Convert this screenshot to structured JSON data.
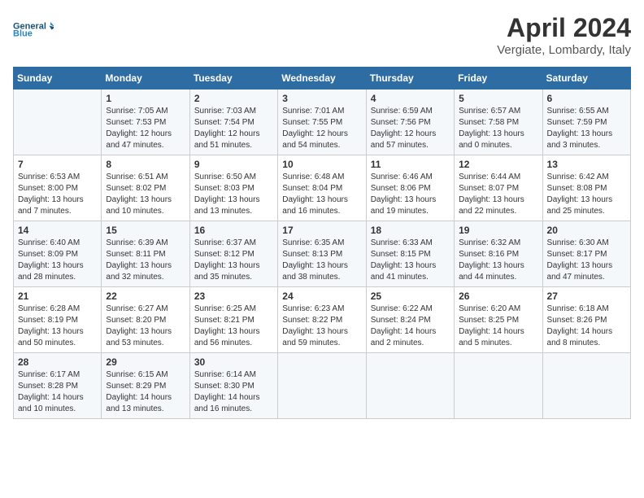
{
  "logo": {
    "text_general": "General",
    "text_blue": "Blue"
  },
  "title": "April 2024",
  "location": "Vergiate, Lombardy, Italy",
  "weekdays": [
    "Sunday",
    "Monday",
    "Tuesday",
    "Wednesday",
    "Thursday",
    "Friday",
    "Saturday"
  ],
  "weeks": [
    [
      {
        "day": "",
        "sunrise": "",
        "sunset": "",
        "daylight": ""
      },
      {
        "day": "1",
        "sunrise": "Sunrise: 7:05 AM",
        "sunset": "Sunset: 7:53 PM",
        "daylight": "Daylight: 12 hours and 47 minutes."
      },
      {
        "day": "2",
        "sunrise": "Sunrise: 7:03 AM",
        "sunset": "Sunset: 7:54 PM",
        "daylight": "Daylight: 12 hours and 51 minutes."
      },
      {
        "day": "3",
        "sunrise": "Sunrise: 7:01 AM",
        "sunset": "Sunset: 7:55 PM",
        "daylight": "Daylight: 12 hours and 54 minutes."
      },
      {
        "day": "4",
        "sunrise": "Sunrise: 6:59 AM",
        "sunset": "Sunset: 7:56 PM",
        "daylight": "Daylight: 12 hours and 57 minutes."
      },
      {
        "day": "5",
        "sunrise": "Sunrise: 6:57 AM",
        "sunset": "Sunset: 7:58 PM",
        "daylight": "Daylight: 13 hours and 0 minutes."
      },
      {
        "day": "6",
        "sunrise": "Sunrise: 6:55 AM",
        "sunset": "Sunset: 7:59 PM",
        "daylight": "Daylight: 13 hours and 3 minutes."
      }
    ],
    [
      {
        "day": "7",
        "sunrise": "Sunrise: 6:53 AM",
        "sunset": "Sunset: 8:00 PM",
        "daylight": "Daylight: 13 hours and 7 minutes."
      },
      {
        "day": "8",
        "sunrise": "Sunrise: 6:51 AM",
        "sunset": "Sunset: 8:02 PM",
        "daylight": "Daylight: 13 hours and 10 minutes."
      },
      {
        "day": "9",
        "sunrise": "Sunrise: 6:50 AM",
        "sunset": "Sunset: 8:03 PM",
        "daylight": "Daylight: 13 hours and 13 minutes."
      },
      {
        "day": "10",
        "sunrise": "Sunrise: 6:48 AM",
        "sunset": "Sunset: 8:04 PM",
        "daylight": "Daylight: 13 hours and 16 minutes."
      },
      {
        "day": "11",
        "sunrise": "Sunrise: 6:46 AM",
        "sunset": "Sunset: 8:06 PM",
        "daylight": "Daylight: 13 hours and 19 minutes."
      },
      {
        "day": "12",
        "sunrise": "Sunrise: 6:44 AM",
        "sunset": "Sunset: 8:07 PM",
        "daylight": "Daylight: 13 hours and 22 minutes."
      },
      {
        "day": "13",
        "sunrise": "Sunrise: 6:42 AM",
        "sunset": "Sunset: 8:08 PM",
        "daylight": "Daylight: 13 hours and 25 minutes."
      }
    ],
    [
      {
        "day": "14",
        "sunrise": "Sunrise: 6:40 AM",
        "sunset": "Sunset: 8:09 PM",
        "daylight": "Daylight: 13 hours and 28 minutes."
      },
      {
        "day": "15",
        "sunrise": "Sunrise: 6:39 AM",
        "sunset": "Sunset: 8:11 PM",
        "daylight": "Daylight: 13 hours and 32 minutes."
      },
      {
        "day": "16",
        "sunrise": "Sunrise: 6:37 AM",
        "sunset": "Sunset: 8:12 PM",
        "daylight": "Daylight: 13 hours and 35 minutes."
      },
      {
        "day": "17",
        "sunrise": "Sunrise: 6:35 AM",
        "sunset": "Sunset: 8:13 PM",
        "daylight": "Daylight: 13 hours and 38 minutes."
      },
      {
        "day": "18",
        "sunrise": "Sunrise: 6:33 AM",
        "sunset": "Sunset: 8:15 PM",
        "daylight": "Daylight: 13 hours and 41 minutes."
      },
      {
        "day": "19",
        "sunrise": "Sunrise: 6:32 AM",
        "sunset": "Sunset: 8:16 PM",
        "daylight": "Daylight: 13 hours and 44 minutes."
      },
      {
        "day": "20",
        "sunrise": "Sunrise: 6:30 AM",
        "sunset": "Sunset: 8:17 PM",
        "daylight": "Daylight: 13 hours and 47 minutes."
      }
    ],
    [
      {
        "day": "21",
        "sunrise": "Sunrise: 6:28 AM",
        "sunset": "Sunset: 8:19 PM",
        "daylight": "Daylight: 13 hours and 50 minutes."
      },
      {
        "day": "22",
        "sunrise": "Sunrise: 6:27 AM",
        "sunset": "Sunset: 8:20 PM",
        "daylight": "Daylight: 13 hours and 53 minutes."
      },
      {
        "day": "23",
        "sunrise": "Sunrise: 6:25 AM",
        "sunset": "Sunset: 8:21 PM",
        "daylight": "Daylight: 13 hours and 56 minutes."
      },
      {
        "day": "24",
        "sunrise": "Sunrise: 6:23 AM",
        "sunset": "Sunset: 8:22 PM",
        "daylight": "Daylight: 13 hours and 59 minutes."
      },
      {
        "day": "25",
        "sunrise": "Sunrise: 6:22 AM",
        "sunset": "Sunset: 8:24 PM",
        "daylight": "Daylight: 14 hours and 2 minutes."
      },
      {
        "day": "26",
        "sunrise": "Sunrise: 6:20 AM",
        "sunset": "Sunset: 8:25 PM",
        "daylight": "Daylight: 14 hours and 5 minutes."
      },
      {
        "day": "27",
        "sunrise": "Sunrise: 6:18 AM",
        "sunset": "Sunset: 8:26 PM",
        "daylight": "Daylight: 14 hours and 8 minutes."
      }
    ],
    [
      {
        "day": "28",
        "sunrise": "Sunrise: 6:17 AM",
        "sunset": "Sunset: 8:28 PM",
        "daylight": "Daylight: 14 hours and 10 minutes."
      },
      {
        "day": "29",
        "sunrise": "Sunrise: 6:15 AM",
        "sunset": "Sunset: 8:29 PM",
        "daylight": "Daylight: 14 hours and 13 minutes."
      },
      {
        "day": "30",
        "sunrise": "Sunrise: 6:14 AM",
        "sunset": "Sunset: 8:30 PM",
        "daylight": "Daylight: 14 hours and 16 minutes."
      },
      {
        "day": "",
        "sunrise": "",
        "sunset": "",
        "daylight": ""
      },
      {
        "day": "",
        "sunrise": "",
        "sunset": "",
        "daylight": ""
      },
      {
        "day": "",
        "sunrise": "",
        "sunset": "",
        "daylight": ""
      },
      {
        "day": "",
        "sunrise": "",
        "sunset": "",
        "daylight": ""
      }
    ]
  ]
}
